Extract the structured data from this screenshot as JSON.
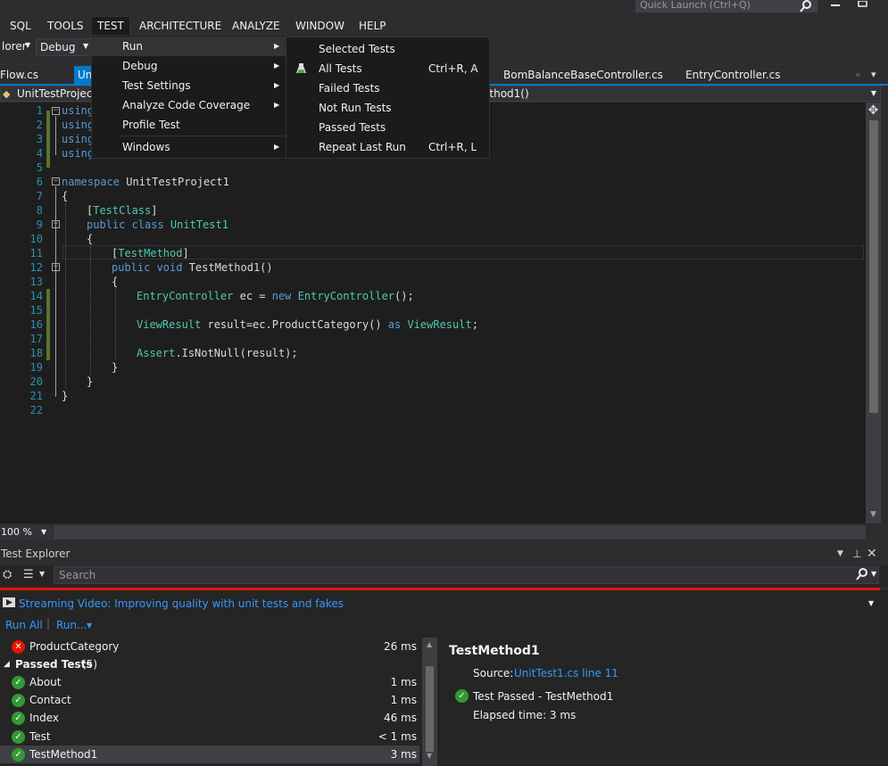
{
  "menubar": {
    "items": [
      "SQL",
      "TOOLS",
      "TEST",
      "ARCHITECTURE",
      "ANALYZE",
      "WINDOW",
      "HELP"
    ],
    "active": "TEST",
    "quick_launch_placeholder": "Quick Launch (Ctrl+Q)"
  },
  "toolbar": {
    "explorer_combo": "lorer",
    "config_combo": "Debug"
  },
  "tabs": [
    {
      "label": "Flow.cs"
    },
    {
      "label": "Uni"
    },
    {
      "label": "BomBalanceBaseController.cs"
    },
    {
      "label": "EntryController.cs"
    }
  ],
  "navbar": {
    "left": "UnitTestProject1",
    "right": "ethod1()"
  },
  "test_menu": {
    "items": [
      {
        "label": "Run",
        "submenu": true
      },
      {
        "label": "Debug",
        "submenu": true
      },
      {
        "label": "Test Settings",
        "submenu": true
      },
      {
        "label": "Analyze Code Coverage",
        "submenu": true
      },
      {
        "label": "Profile Test",
        "submenu": false
      },
      {
        "label": "Windows",
        "submenu": true
      }
    ]
  },
  "run_submenu": {
    "items": [
      {
        "label": "Selected Tests",
        "shortcut": ""
      },
      {
        "label": "All Tests",
        "shortcut": "Ctrl+R, A"
      },
      {
        "label": "Failed Tests",
        "shortcut": ""
      },
      {
        "label": "Not Run Tests",
        "shortcut": ""
      },
      {
        "label": "Passed Tests",
        "shortcut": ""
      },
      {
        "label": "Repeat Last Run",
        "shortcut": "Ctrl+R, L"
      }
    ]
  },
  "editor": {
    "line_numbers": [
      "1",
      "2",
      "3",
      "4",
      "5",
      "6",
      "7",
      "8",
      "9",
      "10",
      "11",
      "12",
      "13",
      "14",
      "15",
      "16",
      "17",
      "18",
      "19",
      "20",
      "21",
      "22"
    ],
    "lines": {
      "l1": "using",
      "l2": "using",
      "l3": "using",
      "l4": "using",
      "l6_kw": "namespace",
      "l6_rest": " UnitTestProject1",
      "l7": "{",
      "l8_open": "[",
      "l8_type": "TestClass",
      "l8_close": "]",
      "l9_kw": "public class",
      "l9_type": " UnitTest1",
      "l10": "{",
      "l11_open": "[",
      "l11_type": "TestMethod",
      "l11_close": "]",
      "l12_kw": "public void",
      "l12_rest": " TestMethod1()",
      "l13": "{",
      "l14_type": "EntryController",
      "l14_mid": " ec = ",
      "l14_kw": "new",
      "l14_type2": " EntryController",
      "l14_end": "();",
      "l16_type": "ViewResult",
      "l16_mid": " result=ec.ProductCategory() ",
      "l16_kw": "as",
      "l16_type2": " ViewResult",
      "l16_end": ";",
      "l18_type": "Assert",
      "l18_rest": ".IsNotNull(result);",
      "l19": "}",
      "l20": "}",
      "l21": "}"
    },
    "zoom": "100 %"
  },
  "test_explorer": {
    "title": "Test Explorer",
    "search_placeholder": "Search",
    "video_link": "Streaming Video: Improving quality with unit tests and fakes",
    "run_all": "Run All",
    "run": "Run...",
    "failed_test": {
      "name": "ProductCategory",
      "duration": "26 ms"
    },
    "passed_group": {
      "label": "Passed Tests",
      "count": "(5)"
    },
    "passed_tests": [
      {
        "name": "About",
        "duration": "1 ms"
      },
      {
        "name": "Contact",
        "duration": "1 ms"
      },
      {
        "name": "Index",
        "duration": "46 ms"
      },
      {
        "name": "Test",
        "duration": "< 1 ms"
      },
      {
        "name": "TestMethod1",
        "duration": "3 ms"
      }
    ],
    "detail": {
      "title": "TestMethod1",
      "source_label": "Source:",
      "source_link": "UnitTest1.cs line 11",
      "result": "Test Passed - TestMethod1",
      "elapsed": "Elapsed time: 3 ms"
    }
  },
  "colors": {
    "accent": "#007acc",
    "fail_bar": "#e51400",
    "pass": "#339933",
    "link": "#3399ff"
  }
}
